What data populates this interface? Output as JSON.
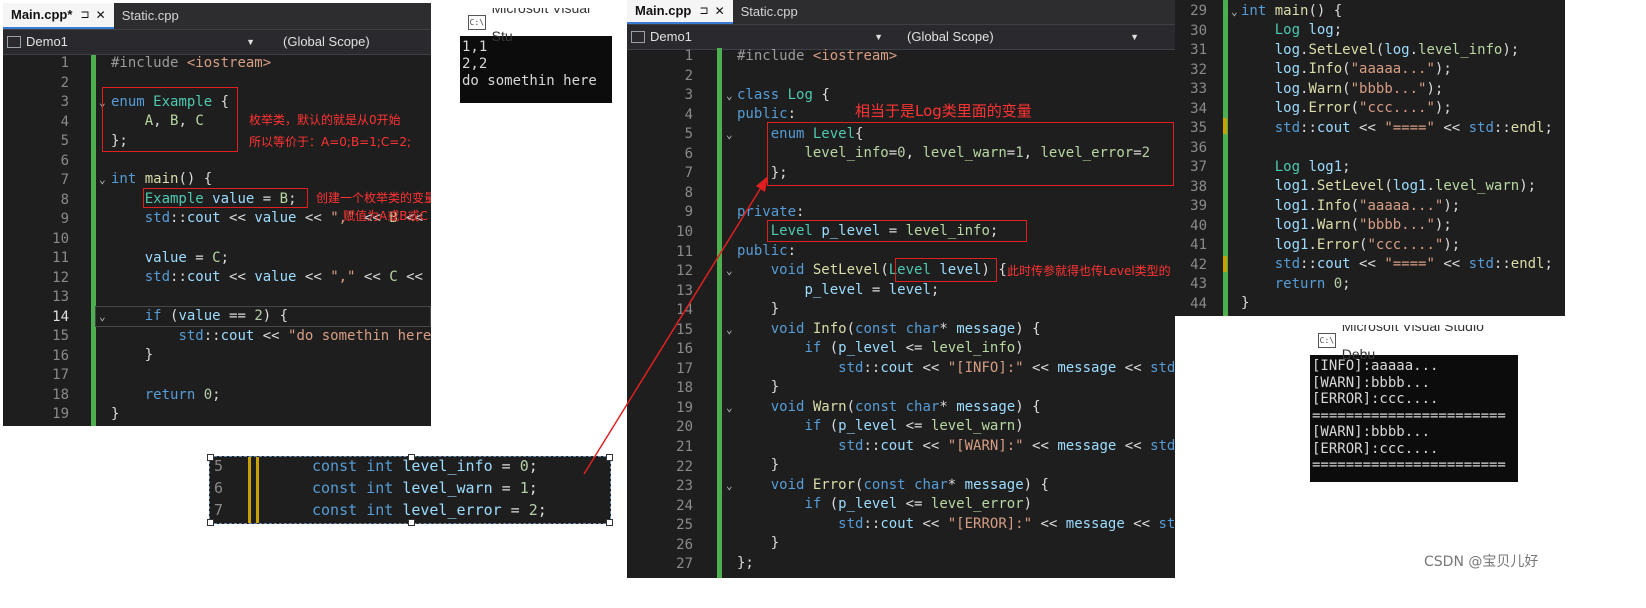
{
  "left_editor": {
    "tabs": [
      {
        "label": "Main.cpp*",
        "active": true
      },
      {
        "label": "Static.cpp",
        "active": false
      }
    ],
    "project": "Demo1",
    "scope": "(Global Scope)",
    "line_numbers": [
      "1",
      "2",
      "3",
      "4",
      "5",
      "6",
      "7",
      "8",
      "9",
      "10",
      "11",
      "12",
      "13",
      "14",
      "15",
      "16",
      "17",
      "18",
      "19"
    ],
    "annotations": {
      "enum_note_1": "枚举类，默认的就是从0开始",
      "enum_note_2": "所以等价于：A=0;B=1;C=2;",
      "var_note_1": "创建一个枚举类的变量value，那value的值就只能",
      "var_note_2": "赋值为A或B或C"
    }
  },
  "console_small": {
    "title": "Microsoft Visual Stu",
    "lines": [
      "1,1",
      "2,2",
      "do somethin here"
    ]
  },
  "snippet": {
    "line_numbers": [
      "5",
      "6",
      "7"
    ]
  },
  "middle_editor": {
    "tabs": [
      {
        "label": "Main.cpp",
        "active": true
      },
      {
        "label": "Static.cpp",
        "active": false
      }
    ],
    "project": "Demo1",
    "scope": "(Global Scope)",
    "line_numbers": [
      "1",
      "2",
      "3",
      "4",
      "5",
      "6",
      "7",
      "8",
      "9",
      "10",
      "11",
      "12",
      "13",
      "14",
      "15",
      "16",
      "17",
      "18",
      "19",
      "20",
      "21",
      "22",
      "23",
      "24",
      "25",
      "26",
      "27"
    ],
    "annotations": {
      "level_note": "相当于是Log类里面的变量",
      "param_note": "此时传参就得也传Level类型的"
    }
  },
  "right_editor": {
    "line_numbers": [
      "29",
      "30",
      "31",
      "32",
      "33",
      "34",
      "35",
      "36",
      "37",
      "38",
      "39",
      "40",
      "41",
      "42",
      "43",
      "44"
    ]
  },
  "console_large": {
    "title": "Microsoft Visual Studio Debu",
    "lines": [
      "[INFO]:aaaaa...",
      "[WARN]:bbbb...",
      "[ERROR]:ccc....",
      "=======================",
      "[WARN]:bbbb...",
      "[ERROR]:ccc....",
      "======================="
    ]
  },
  "watermark": "CSDN @宝贝儿好",
  "colors": {
    "annotation": "#ff3333",
    "margin": "#4caf50",
    "bg": "#1e1e1e"
  }
}
